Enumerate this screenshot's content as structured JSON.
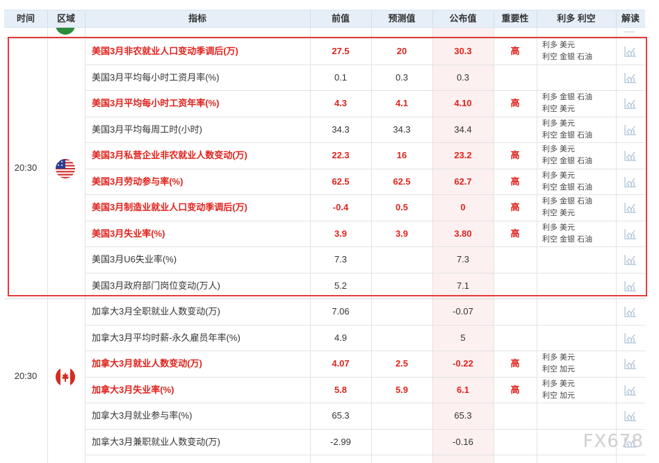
{
  "columns": {
    "time": "时间",
    "region": "区域",
    "indicator": "指标",
    "previous": "前值",
    "forecast": "预测值",
    "actual": "公布值",
    "importance": "重要性",
    "effect": "利多 利空",
    "analysis": "解读"
  },
  "groups": [
    {
      "time": "20:30",
      "flag": "us-flag"
    },
    {
      "time": "20:30",
      "flag": "canada-flag"
    }
  ],
  "rows": [
    {
      "indicator": "美国3月非农就业人口变动季调后(万)",
      "previous": "27.5",
      "forecast": "20",
      "actual": "30.3",
      "importance": "高",
      "bold": true,
      "effect1": "利多  美元",
      "effect2": "利空  金银 石油"
    },
    {
      "indicator": "美国3月平均每小时工资月率(%)",
      "previous": "0.1",
      "forecast": "0.3",
      "actual": "0.3",
      "importance": "",
      "bold": false,
      "effect1": "",
      "effect2": ""
    },
    {
      "indicator": "美国3月平均每小时工资年率(%)",
      "previous": "4.3",
      "forecast": "4.1",
      "actual": "4.10",
      "importance": "高",
      "bold": true,
      "effect1": "利多  金银 石油",
      "effect2": "利空  美元"
    },
    {
      "indicator": "美国3月平均每周工时(小时)",
      "previous": "34.3",
      "forecast": "34.3",
      "actual": "34.4",
      "importance": "",
      "bold": false,
      "effect1": "利多  美元",
      "effect2": "利空  金银 石油"
    },
    {
      "indicator": "美国3月私营企业非农就业人数变动(万)",
      "previous": "22.3",
      "forecast": "16",
      "actual": "23.2",
      "importance": "高",
      "bold": true,
      "effect1": "利多  美元",
      "effect2": "利空  金银 石油"
    },
    {
      "indicator": "美国3月劳动参与率(%)",
      "previous": "62.5",
      "forecast": "62.5",
      "actual": "62.7",
      "importance": "高",
      "bold": true,
      "effect1": "利多  美元",
      "effect2": "利空  金银 石油"
    },
    {
      "indicator": "美国3月制造业就业人口变动季调后(万)",
      "previous": "-0.4",
      "forecast": "0.5",
      "actual": "0",
      "importance": "高",
      "bold": true,
      "effect1": "利多  金银 石油",
      "effect2": "利空  美元"
    },
    {
      "indicator": "美国3月失业率(%)",
      "previous": "3.9",
      "forecast": "3.9",
      "actual": "3.80",
      "importance": "高",
      "bold": true,
      "effect1": "利多  美元",
      "effect2": "利空  金银 石油"
    },
    {
      "indicator": "美国3月U6失业率(%)",
      "previous": "7.3",
      "forecast": "",
      "actual": "7.3",
      "importance": "",
      "bold": false,
      "effect1": "",
      "effect2": ""
    },
    {
      "indicator": "美国3月政府部门岗位变动(万人)",
      "previous": "5.2",
      "forecast": "",
      "actual": "7.1",
      "importance": "",
      "bold": false,
      "effect1": "",
      "effect2": ""
    },
    {
      "indicator": "加拿大3月全职就业人数变动(万)",
      "previous": "7.06",
      "forecast": "",
      "actual": "-0.07",
      "importance": "",
      "bold": false,
      "effect1": "",
      "effect2": ""
    },
    {
      "indicator": "加拿大3月平均时薪-永久雇员年率(%)",
      "previous": "4.9",
      "forecast": "",
      "actual": "5",
      "importance": "",
      "bold": false,
      "effect1": "",
      "effect2": ""
    },
    {
      "indicator": "加拿大3月就业人数变动(万)",
      "previous": "4.07",
      "forecast": "2.5",
      "actual": "-0.22",
      "importance": "高",
      "bold": true,
      "effect1": "利多  美元",
      "effect2": "利空  加元"
    },
    {
      "indicator": "加拿大3月失业率(%)",
      "previous": "5.8",
      "forecast": "5.9",
      "actual": "6.1",
      "importance": "高",
      "bold": true,
      "effect1": "利多  美元",
      "effect2": "利空  加元"
    },
    {
      "indicator": "加拿大3月就业参与率(%)",
      "previous": "65.3",
      "forecast": "",
      "actual": "65.3",
      "importance": "",
      "bold": false,
      "effect1": "",
      "effect2": ""
    },
    {
      "indicator": "加拿大3月兼职就业人数变动(万)",
      "previous": "-2.99",
      "forecast": "",
      "actual": "-0.16",
      "importance": "",
      "bold": false,
      "effect1": "",
      "effect2": ""
    }
  ],
  "watermark": "FX678",
  "colors": {
    "accent": "#e0231d",
    "header_bg": "#e6eff8",
    "highlight_border": "#e33a3a"
  }
}
